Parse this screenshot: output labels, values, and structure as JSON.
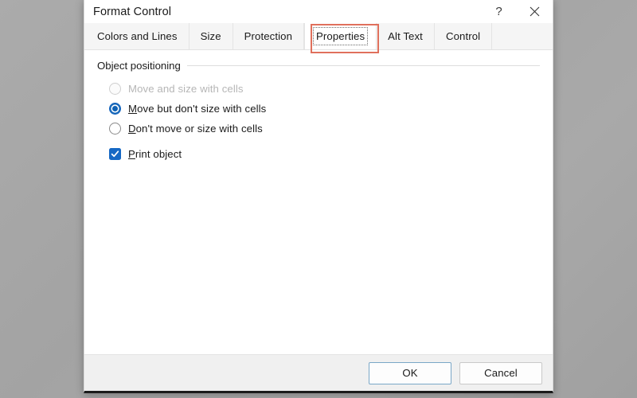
{
  "window": {
    "title": "Format Control",
    "caption_buttons": [
      {
        "name": "help-button",
        "glyph": "?"
      },
      {
        "name": "close-button",
        "glyph": "✕"
      }
    ]
  },
  "tabs": [
    {
      "label": "Colors and Lines",
      "selected": false
    },
    {
      "label": "Size",
      "selected": false
    },
    {
      "label": "Protection",
      "selected": false
    },
    {
      "label": "Properties",
      "selected": true,
      "highlighted": true
    },
    {
      "label": "Alt Text",
      "selected": false
    },
    {
      "label": "Control",
      "selected": false
    }
  ],
  "panel": {
    "group_title": "Object positioning",
    "radios": [
      {
        "label": "Move and size with cells",
        "accel": "",
        "prefix": "Move and size with cells",
        "checked": false,
        "disabled": true
      },
      {
        "label": "Move but don't size with cells",
        "accel": "M",
        "rest": "ove but don't size with cells",
        "checked": true,
        "disabled": false
      },
      {
        "label": "Don't move or size with cells",
        "accel": "D",
        "rest": "on't move or size with cells",
        "checked": false,
        "disabled": false
      }
    ],
    "checkbox": {
      "label": "Print object",
      "accel": "P",
      "rest": "rint object",
      "checked": true
    }
  },
  "footer": {
    "ok_label": "OK",
    "cancel_label": "Cancel"
  },
  "colors": {
    "accent_blue": "#0f62b5",
    "checkbox_blue": "#1668c4",
    "annotation_red": "#e0705c",
    "desktop_gray": "#a6a6a6",
    "footer_gray": "#f0f0f0",
    "tabstrip_gray": "#f5f5f5",
    "disabled_text": "#b6b6b6"
  }
}
